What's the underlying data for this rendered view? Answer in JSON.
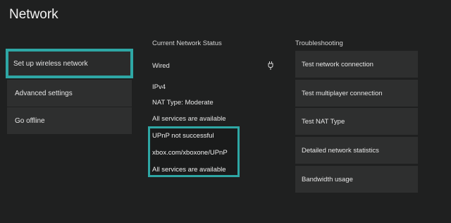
{
  "header": {
    "title": "Network"
  },
  "menu": {
    "items": [
      {
        "label": "Set up wireless network"
      },
      {
        "label": "Advanced settings"
      },
      {
        "label": "Go offline"
      }
    ]
  },
  "status": {
    "header": "Current Network Status",
    "connection": "Wired",
    "connection_icon": "ethernet-plug-icon",
    "ip_version": "IPv4",
    "nat_type": "NAT Type: Moderate",
    "services": "All services are available",
    "highlight": {
      "upnp": "UPnP not successful",
      "link": "xbox.com/xboxone/UPnP",
      "services": "All services are available"
    }
  },
  "troubleshooting": {
    "header": "Troubleshooting",
    "items": [
      {
        "label": "Test network connection"
      },
      {
        "label": "Test multiplayer connection"
      },
      {
        "label": "Test NAT Type"
      },
      {
        "label": "Detailed network statistics"
      },
      {
        "label": "Bandwidth usage"
      }
    ]
  },
  "colors": {
    "background": "#1f2020",
    "tile": "#2e2f2f",
    "accent": "#2ea7a5"
  }
}
